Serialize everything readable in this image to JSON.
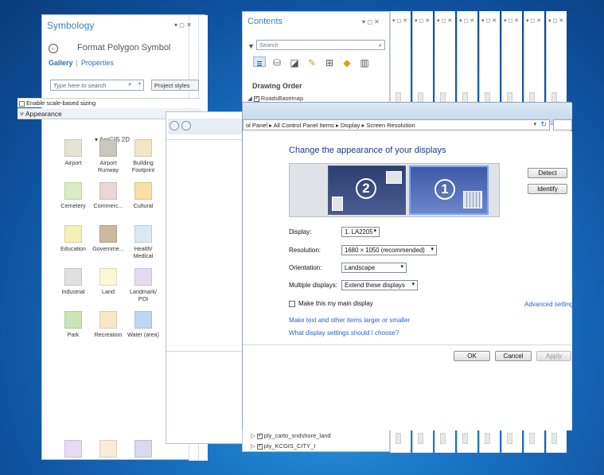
{
  "symbology": {
    "title": "Symbology",
    "controls": "▾ ◻ ✕",
    "back": "←",
    "subtitle": "Format Polygon Symbol",
    "tab_gallery": "Gallery",
    "tab_separator": "|",
    "tab_properties": "Properties",
    "search_placeholder": "Type here to search",
    "project_styles": "Project styles",
    "scale_label": "Enable scale-based sizing",
    "appearance": "Appearance",
    "group_label": "ArcGIS 2D",
    "symbols": [
      {
        "label": "Airport",
        "color": "#e4e4d2"
      },
      {
        "label": "Airport Runway",
        "color": "#c7c7bd"
      },
      {
        "label": "Building Footprint",
        "color": "#f1e6c7"
      },
      {
        "label": "Cemetery",
        "color": "#d9ecc4"
      },
      {
        "label": "Commerc...",
        "color": "#ead6d4"
      },
      {
        "label": "Cultural",
        "color": "#f9e0a6"
      },
      {
        "label": "Education",
        "color": "#f5f0b5"
      },
      {
        "label": "Governme...",
        "color": "#cdb79d"
      },
      {
        "label": "Health/ Medical",
        "color": "#d9e9f4"
      },
      {
        "label": "Industrial",
        "color": "#e0e0e0"
      },
      {
        "label": "Land",
        "color": "#fbf8d6"
      },
      {
        "label": "Landmark/ POI",
        "color": "#e6daf2"
      },
      {
        "label": "Park",
        "color": "#c9e5b4"
      },
      {
        "label": "Recreation",
        "color": "#f8e7c6"
      },
      {
        "label": "Water (area)",
        "color": "#bfd8f2"
      },
      {
        "label": "",
        "color": "#e8daf2"
      },
      {
        "label": "",
        "color": "#f6ecd9"
      },
      {
        "label": "",
        "color": "#d8d8ee"
      }
    ]
  },
  "contents": {
    "title": "Contents",
    "controls": "▾ ◻ ✕",
    "search_placeholder": "Search",
    "drawing_order": "Drawing Order",
    "layer_top": "RoadsBasemap",
    "layer_bottom_1": "ply_carto_sndshore_land",
    "layer_bottom_2": "ply_KCGIS_CITY_I"
  },
  "stripe_headers": [
    "▾ ◻ ✕",
    "▾ ◻ ✕",
    "▾ ◻ ✕",
    "▾ ◻ ✕",
    "▾ ◻ ✕",
    "▾ ◻ ✕",
    "▾ ◻ ✕",
    "▾ ◻ ✕"
  ],
  "screen_res": {
    "breadcrumb": "ol Panel  ▸  All Control Panel Items  ▸  Display  ▸  Screen Resolution",
    "heading": "Change the appearance of your displays",
    "monitor_2": "2",
    "monitor_1": "1",
    "detect": "Detect",
    "identify": "Identify",
    "display_label": "Display:",
    "display_value": "1. LA2205",
    "resolution_label": "Resolution:",
    "resolution_value": "1680 × 1050 (recommended)",
    "orientation_label": "Orientation:",
    "orientation_value": "Landscape",
    "multiple_label": "Multiple displays:",
    "multiple_value": "Extend these displays",
    "main_display": "Make this my main display",
    "advanced": "Advanced settings",
    "link_text_size": "Make text and other items larger or smaller",
    "link_which": "What display settings should I choose?",
    "ok": "OK",
    "cancel": "Cancel",
    "apply": "Apply"
  }
}
